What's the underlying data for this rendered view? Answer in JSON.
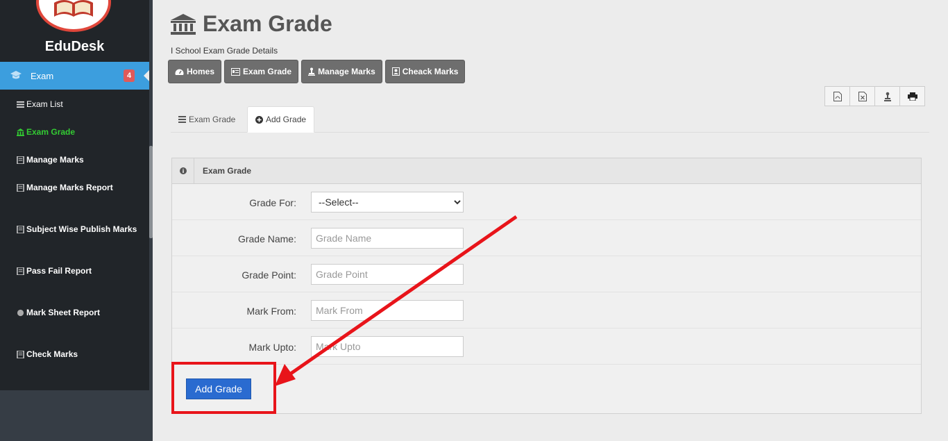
{
  "sidebar": {
    "brand": "EduDesk",
    "active_item": {
      "label": "Exam",
      "badge": "4"
    },
    "items": [
      {
        "label": "Exam List"
      },
      {
        "label": "Exam Grade"
      },
      {
        "label": "Manage Marks"
      },
      {
        "label": "Manage Marks Report"
      },
      {
        "label": "Subject Wise Publish Marks"
      },
      {
        "label": "Pass Fail Report"
      },
      {
        "label": "Mark Sheet Report"
      },
      {
        "label": "Check Marks"
      }
    ]
  },
  "header": {
    "title": "Exam Grade",
    "subtitle": "I School Exam Grade Details"
  },
  "quick_nav": [
    "Homes",
    "Exam Grade",
    "Manage Marks",
    "Cheack Marks"
  ],
  "tabs": [
    "Exam Grade",
    "Add Grade"
  ],
  "panel": {
    "title": "Exam Grade",
    "fields": [
      {
        "label": "Grade For:",
        "value": "--Select--"
      },
      {
        "label": "Grade Name:",
        "placeholder": "Grade Name"
      },
      {
        "label": "Grade Point:",
        "placeholder": "Grade Point"
      },
      {
        "label": "Mark From:",
        "placeholder": "Mark From"
      },
      {
        "label": "Mark Upto:",
        "placeholder": "Mark Upto"
      }
    ],
    "submit_label": "Add Grade"
  },
  "colors": {
    "sidebar": "#212529",
    "active": "#3c9ede",
    "active_submenu": "#33cc33",
    "badge": "#e05a5a",
    "button_primary": "#2a6bd0",
    "annotation": "#e8141a"
  }
}
